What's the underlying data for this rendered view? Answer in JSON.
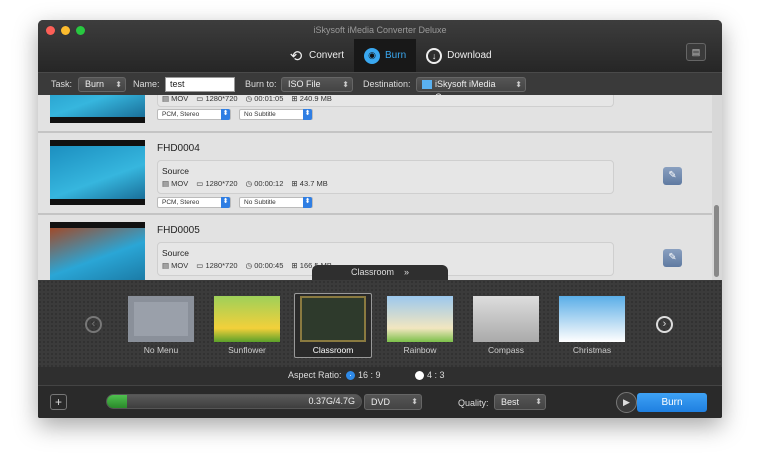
{
  "window": {
    "title": "iSkysoft iMedia Converter Deluxe"
  },
  "nav": {
    "convert": "Convert",
    "burn": "Burn",
    "download": "Download"
  },
  "taskbar": {
    "task_label": "Task:",
    "task_value": "Burn",
    "name_label": "Name:",
    "name_value": "test",
    "burn_to_label": "Burn to:",
    "burn_to_value": "ISO File",
    "destination_label": "Destination:",
    "destination_value": "iSkysoft iMedia C..."
  },
  "files": [
    {
      "title": "",
      "source": "",
      "format": "MOV",
      "resolution": "1280*720",
      "duration": "00:01:05",
      "size": "240.9 MB",
      "audio": "PCM, Stereo",
      "subtitle": "No Subtitle"
    },
    {
      "title": "FHD0004",
      "source": "Source",
      "format": "MOV",
      "resolution": "1280*720",
      "duration": "00:00:12",
      "size": "43.7 MB",
      "audio": "PCM, Stereo",
      "subtitle": "No Subtitle"
    },
    {
      "title": "FHD0005",
      "source": "Source",
      "format": "MOV",
      "resolution": "1280*720",
      "duration": "00:00:45",
      "size": "166.5 MB"
    }
  ],
  "menu_tab": "Classroom",
  "menus": [
    "No Menu",
    "Sunflower",
    "Classroom",
    "Rainbow",
    "Compass",
    "Christmas"
  ],
  "selected_menu": "Classroom",
  "aspect": {
    "label": "Aspect Ratio:",
    "opt1": "16 : 9",
    "opt2": "4 : 3",
    "selected": "16 : 9"
  },
  "bottom": {
    "usage": "0.37G/4.7G",
    "usage_fraction": 0.079,
    "disc": "DVD",
    "quality_label": "Quality:",
    "quality": "Best",
    "burn": "Burn"
  },
  "colors": {
    "accent": "#2f8ae8",
    "progress": "#3aa53a"
  }
}
